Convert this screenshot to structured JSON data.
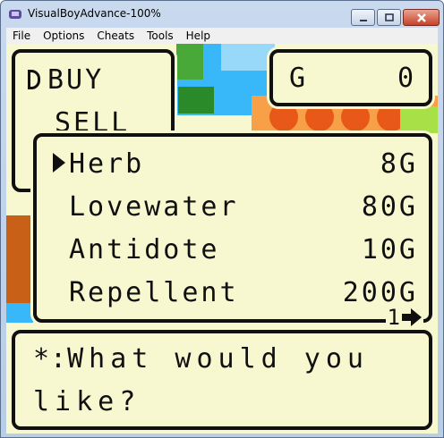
{
  "window": {
    "title": "VisualBoyAdvance-100%",
    "buttons": {
      "minimize": "—",
      "maximize": "□",
      "close": "✕"
    }
  },
  "menu": {
    "items": [
      "File",
      "Options",
      "Cheats",
      "Tools",
      "Help"
    ]
  },
  "shop": {
    "actions": {
      "buy": "BUY",
      "sell": "SELL"
    },
    "gold": {
      "label": "G",
      "value": "0"
    },
    "items": [
      {
        "name": "Herb",
        "price": "8G"
      },
      {
        "name": "Lovewater",
        "price": "80G"
      },
      {
        "name": "Antidote",
        "price": "10G"
      },
      {
        "name": "Repellent",
        "price": "200G"
      }
    ],
    "page": "1",
    "page_arrow_icon": "arrow-right-icon",
    "message": {
      "speaker": "*:",
      "line1": "What would you",
      "line2": "like?"
    }
  },
  "colors": {
    "panel": "#f8f8d0",
    "ink": "#101010",
    "sky": "#38b8f8",
    "tree": "#48a838",
    "roof": "#e85818"
  }
}
